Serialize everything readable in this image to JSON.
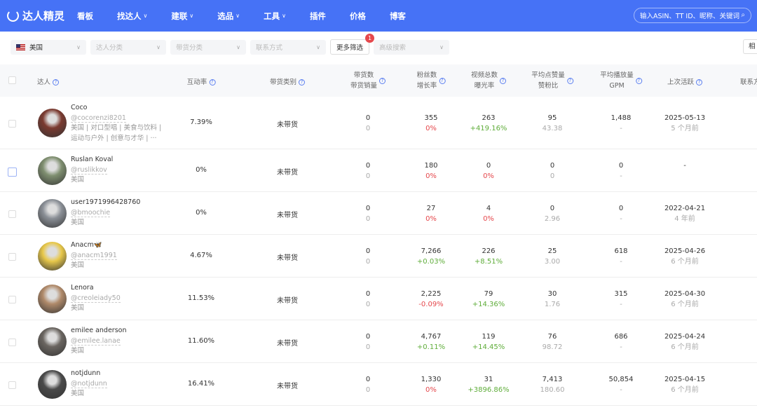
{
  "nav": {
    "brand": "达人精灵",
    "items": [
      {
        "label": "看板",
        "dropdown": false
      },
      {
        "label": "找达人",
        "dropdown": true
      },
      {
        "label": "建联",
        "dropdown": true
      },
      {
        "label": "选品",
        "dropdown": true
      },
      {
        "label": "工具",
        "dropdown": true
      },
      {
        "label": "插件",
        "dropdown": false
      },
      {
        "label": "价格",
        "dropdown": false
      },
      {
        "label": "博客",
        "dropdown": false
      }
    ],
    "search_placeholder": "输入ASIN、TT ID、昵称、关键词"
  },
  "filters": {
    "country": "美国",
    "category": "达人分类",
    "goods_category": "带货分类",
    "contact": "联系方式",
    "more": "更多筛选",
    "more_badge": "1",
    "advanced": "高级搜索",
    "right_button": "相关"
  },
  "columns": [
    "达人",
    "互动率",
    "带货类别",
    [
      "带货数",
      "带货销量"
    ],
    [
      "粉丝数",
      "增长率"
    ],
    [
      "视频总数",
      "曝光率"
    ],
    [
      "平均点赞量",
      "赞粉比"
    ],
    [
      "平均播放量",
      "GPM"
    ],
    "上次活跃",
    "联系方式"
  ],
  "colors": {
    "nav": "#4672f6",
    "negative": "#e5484d",
    "positive": "#5fad3a"
  },
  "rows": [
    {
      "name": "Coco",
      "handle": "@cocorenzi8201",
      "tags": [
        "美国 | 对口型唱 | 美食与饮料 |",
        "运动与户外 | 创意与才华 | ···"
      ],
      "engagement": "7.39%",
      "goods": "未带货",
      "sales": [
        "0",
        "0"
      ],
      "fans": [
        "355",
        "0%"
      ],
      "videos": [
        "263",
        "+419.16%"
      ],
      "likes": [
        "95",
        "43.38"
      ],
      "plays": [
        "1,488",
        "-"
      ],
      "active": [
        "2025-05-13",
        "5 个月前"
      ],
      "avatar": "#7a3a30"
    },
    {
      "name": "Ruslan Koval",
      "handle": "@ruslikkov",
      "tags": [
        "美国"
      ],
      "engagement": "0%",
      "goods": "未带货",
      "sales": [
        "0",
        "0"
      ],
      "fans": [
        "180",
        "0%"
      ],
      "videos": [
        "0",
        "0%"
      ],
      "likes": [
        "0",
        "0"
      ],
      "plays": [
        "0",
        "-"
      ],
      "active": [
        "-",
        ""
      ],
      "avatar": "#7f8f70"
    },
    {
      "name": "user1971996428760",
      "handle": "@bmoochie",
      "tags": [
        "美国"
      ],
      "engagement": "0%",
      "goods": "未带货",
      "sales": [
        "0",
        "0"
      ],
      "fans": [
        "27",
        "0%"
      ],
      "videos": [
        "4",
        "0%"
      ],
      "likes": [
        "0",
        "2.96"
      ],
      "plays": [
        "0",
        "-"
      ],
      "active": [
        "2022-04-21",
        "4 年前"
      ],
      "avatar": "#8a8f96"
    },
    {
      "name": "Anacm🦋",
      "handle": "@anacm1991",
      "tags": [
        "美国"
      ],
      "engagement": "4.67%",
      "goods": "未带货",
      "sales": [
        "0",
        "0"
      ],
      "fans": [
        "7,266",
        "+0.03%"
      ],
      "videos": [
        "226",
        "+8.51%"
      ],
      "likes": [
        "25",
        "3.00"
      ],
      "plays": [
        "618",
        "-"
      ],
      "active": [
        "2025-04-26",
        "6 个月前"
      ],
      "avatar": "#e8c84a"
    },
    {
      "name": "Lenora",
      "handle": "@creoleiady50",
      "tags": [
        "美国"
      ],
      "engagement": "11.53%",
      "goods": "未带货",
      "sales": [
        "0",
        "0"
      ],
      "fans": [
        "2,225",
        "-0.09%"
      ],
      "videos": [
        "79",
        "+14.36%"
      ],
      "likes": [
        "30",
        "1.76"
      ],
      "plays": [
        "315",
        "-"
      ],
      "active": [
        "2025-04-30",
        "6 个月前"
      ],
      "avatar": "#b08a6a"
    },
    {
      "name": "emilee anderson",
      "handle": "@emilee.lanae",
      "tags": [
        "美国"
      ],
      "engagement": "11.60%",
      "goods": "未带货",
      "sales": [
        "0",
        "0"
      ],
      "fans": [
        "4,767",
        "+0.11%"
      ],
      "videos": [
        "119",
        "+14.45%"
      ],
      "likes": [
        "76",
        "98.72"
      ],
      "plays": [
        "686",
        "-"
      ],
      "active": [
        "2025-04-24",
        "6 个月前"
      ],
      "avatar": "#6a6560"
    },
    {
      "name": "notjdunn",
      "handle": "@notjdunn",
      "tags": [
        "美国"
      ],
      "engagement": "16.41%",
      "goods": "未带货",
      "sales": [
        "0",
        "0"
      ],
      "fans": [
        "1,330",
        "0%"
      ],
      "videos": [
        "31",
        "+3896.86%"
      ],
      "likes": [
        "7,413",
        "180.60"
      ],
      "plays": [
        "50,854",
        "-"
      ],
      "active": [
        "2025-04-15",
        "6 个月前"
      ],
      "avatar": "#4a4a4a"
    }
  ]
}
